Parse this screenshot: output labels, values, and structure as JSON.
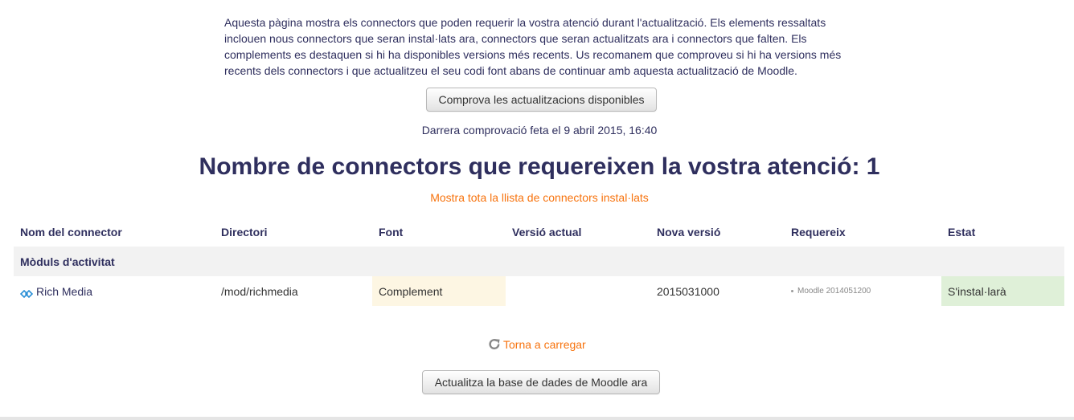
{
  "intro_text": "Aquesta pàgina mostra els connectors que poden requerir la vostra atenció durant l'actualització. Els elements ressaltats inclouen nous connectors que seran instal·lats ara, connectors que seran actualitzats ara i connectors que falten. Els complements es destaquen si hi ha disponibles versions més recents. Us recomanem que comproveu si hi ha versions més recents dels connectors i que actualitzeu el seu codi font abans de continuar amb aquesta actualització de Moodle.",
  "check_updates_label": "Comprova les actualitzacions disponibles",
  "last_check": "Darrera comprovació feta el 9 abril 2015, 16:40",
  "heading": "Nombre de connectors que requereixen la vostra atenció: 1",
  "show_all_link": "Mostra tota la llista de connectors instal·lats",
  "table": {
    "headers": {
      "name": "Nom del connector",
      "directory": "Directori",
      "source": "Font",
      "current_version": "Versió actual",
      "new_version": "Nova versió",
      "requires": "Requereix",
      "status": "Estat"
    },
    "group": "Mòduls d'activitat",
    "plugin": {
      "name": "Rich Media",
      "icon": "rich-media-icon",
      "directory": "/mod/richmedia",
      "source": "Complement",
      "current_version": "",
      "new_version": "2015031000",
      "requires": "Moodle 2014051200",
      "status": "S'instal·larà"
    }
  },
  "reload_link": "Torna a carregar",
  "upgrade_button": "Actualitza la base de dades de Moodle ara",
  "colors": {
    "heading": "#2f2f5e",
    "link": "#f7730e",
    "addon_highlight": "#fdf6e3",
    "status_highlight": "#dff0d8",
    "group_row": "#f2f2f2"
  }
}
